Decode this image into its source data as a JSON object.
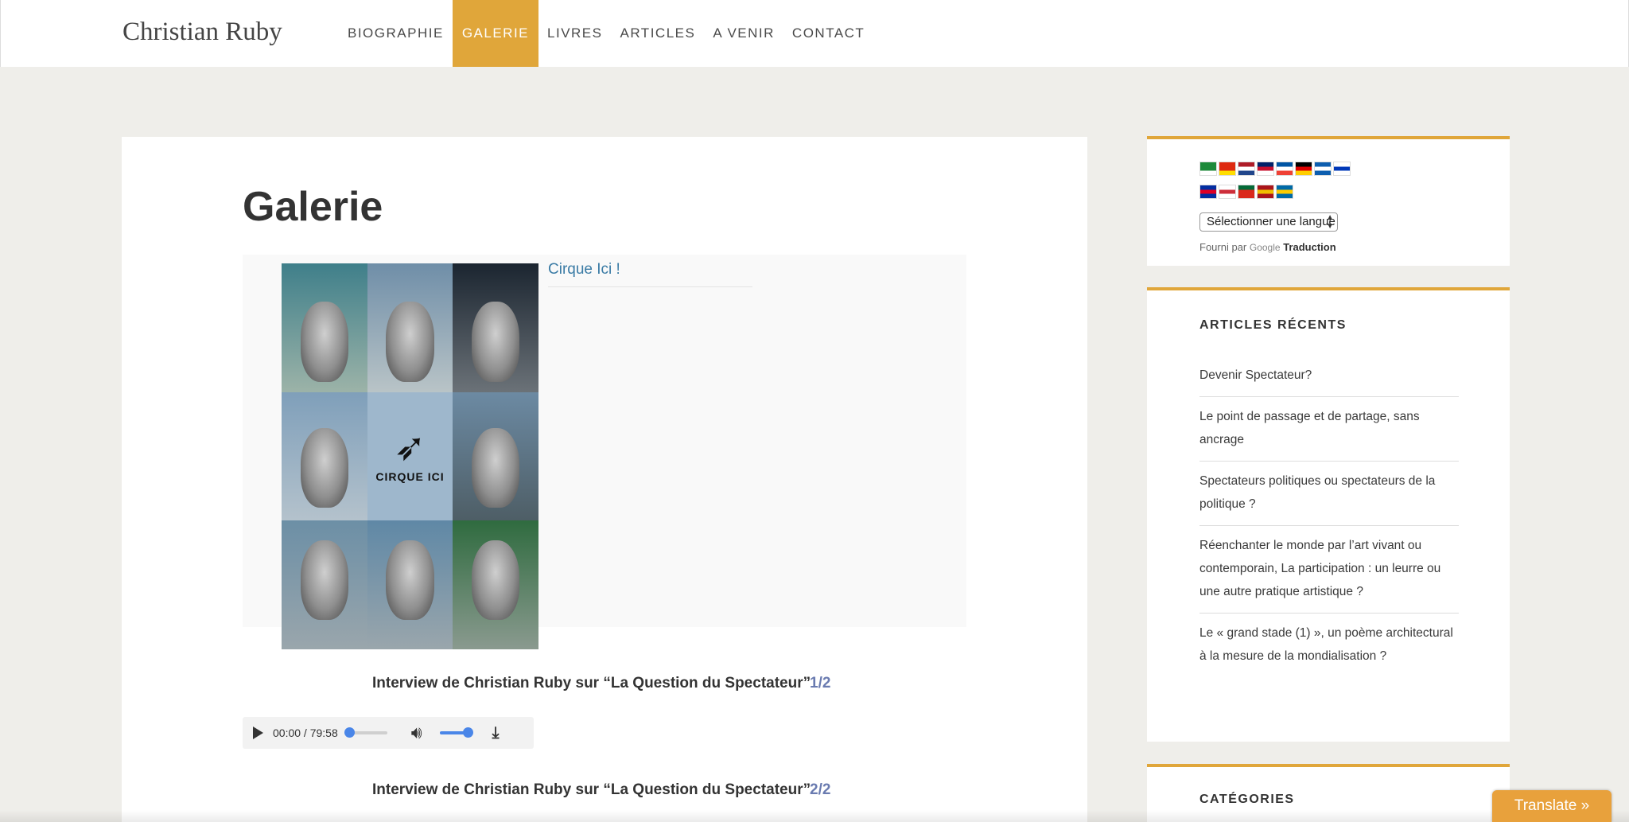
{
  "header": {
    "site_title": "Christian Ruby",
    "nav": [
      {
        "label": "BIOGRAPHIE",
        "active": false
      },
      {
        "label": "GALERIE",
        "active": true
      },
      {
        "label": "LIVRES",
        "active": false
      },
      {
        "label": "ARTICLES",
        "active": false
      },
      {
        "label": "A VENIR",
        "active": false
      },
      {
        "label": "CONTACT",
        "active": false
      }
    ]
  },
  "main": {
    "title": "Galerie",
    "gallery": {
      "link_text": "Cirque Ici !",
      "poster_logo": "CIRQUE ICI"
    },
    "tracks": [
      {
        "title": "Interview de Christian Ruby sur “La Question du Spectateur”",
        "count": "1/2"
      },
      {
        "title": "Interview de Christian Ruby sur “La Question du Spectateur”",
        "count": "2/2"
      }
    ],
    "player": {
      "time": "00:00 / 79:58",
      "progress": 0,
      "volume": 1
    }
  },
  "sidebar": {
    "translate_widget": {
      "select_value": "Sélectionner une langue",
      "powered_by": "Fourni par",
      "google": "Google",
      "translation": "Traduction",
      "flags_row1": [
        {
          "name": "arabic",
          "colors": [
            "#1d8a3a",
            "#1d8a3a",
            "#fff"
          ]
        },
        {
          "name": "chinese",
          "colors": [
            "#de2910",
            "#de2910",
            "#ffde00"
          ]
        },
        {
          "name": "dutch",
          "colors": [
            "#ae1c28",
            "#ffffff",
            "#21468b"
          ]
        },
        {
          "name": "english",
          "colors": [
            "#012169",
            "#c8102e",
            "#ffffff"
          ]
        },
        {
          "name": "french",
          "colors": [
            "#0055a4",
            "#ffffff",
            "#ef4135"
          ]
        },
        {
          "name": "german",
          "colors": [
            "#000000",
            "#dd0000",
            "#ffce00"
          ]
        },
        {
          "name": "greek",
          "colors": [
            "#0d5eaf",
            "#ffffff",
            "#0d5eaf"
          ]
        },
        {
          "name": "hebrew",
          "colors": [
            "#ffffff",
            "#0038b8",
            "#ffffff"
          ]
        }
      ],
      "flags_row2": [
        {
          "name": "khmer",
          "colors": [
            "#032ea1",
            "#e00025",
            "#032ea1"
          ]
        },
        {
          "name": "korean",
          "colors": [
            "#ffffff",
            "#cd2e3a",
            "#ffffff"
          ]
        },
        {
          "name": "portuguese",
          "colors": [
            "#046a38",
            "#da291c",
            "#da291c"
          ]
        },
        {
          "name": "spanish",
          "colors": [
            "#aa151b",
            "#f1bf00",
            "#aa151b"
          ]
        },
        {
          "name": "swedish",
          "colors": [
            "#006aa7",
            "#fecc00",
            "#006aa7"
          ]
        }
      ]
    },
    "recent_articles": {
      "title": "ARTICLES RÉCENTS",
      "items": [
        "Devenir Spectateur?",
        "Le point de passage et de partage, sans ancrage",
        "Spectateurs politiques ou spectateurs de la politique ?",
        "Réenchanter le monde par l’art vivant ou contemporain, La participation : un leurre ou une autre pratique artistique ?",
        "Le « grand stade (1) », un poème architectural à la mesure de la mondialisation ?"
      ]
    },
    "categories": {
      "title": "CATÉGORIES"
    }
  },
  "translate_button": "Translate »",
  "colors": {
    "accent": "#e0a63a",
    "link": "#3a7ba5",
    "count": "#6a7bb0"
  }
}
